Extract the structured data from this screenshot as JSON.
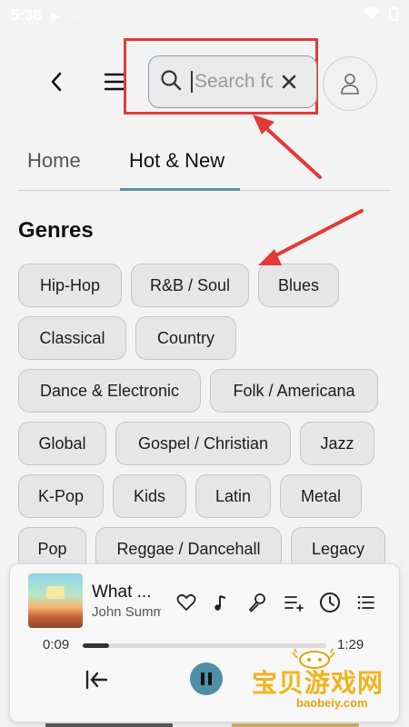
{
  "status_bar": {
    "time": "5:38"
  },
  "search": {
    "placeholder": "Search fo"
  },
  "tabs": [
    {
      "label": "Home",
      "active": false
    },
    {
      "label": "Hot & New",
      "active": true
    }
  ],
  "genres": {
    "title": "Genres",
    "items": [
      "Hip-Hop",
      "R&B / Soul",
      "Blues",
      "Classical",
      "Country",
      "Dance & Electronic",
      "Folk / Americana",
      "Global",
      "Gospel / Christian",
      "Jazz",
      "K-Pop",
      "Kids",
      "Latin",
      "Metal",
      "Pop",
      "Reggae / Dancehall",
      "Legacy"
    ]
  },
  "player": {
    "song_title": "What ...",
    "artist": "John Summ",
    "current_time": "0:09",
    "duration": "1:29",
    "progress": 0.11
  },
  "watermark": {
    "text": "宝贝游戏网",
    "url": "baobeiy.com"
  },
  "colors": {
    "accent": "#5b8fa8",
    "pause_button": "#4d8ea8",
    "highlight": "#e53935"
  }
}
